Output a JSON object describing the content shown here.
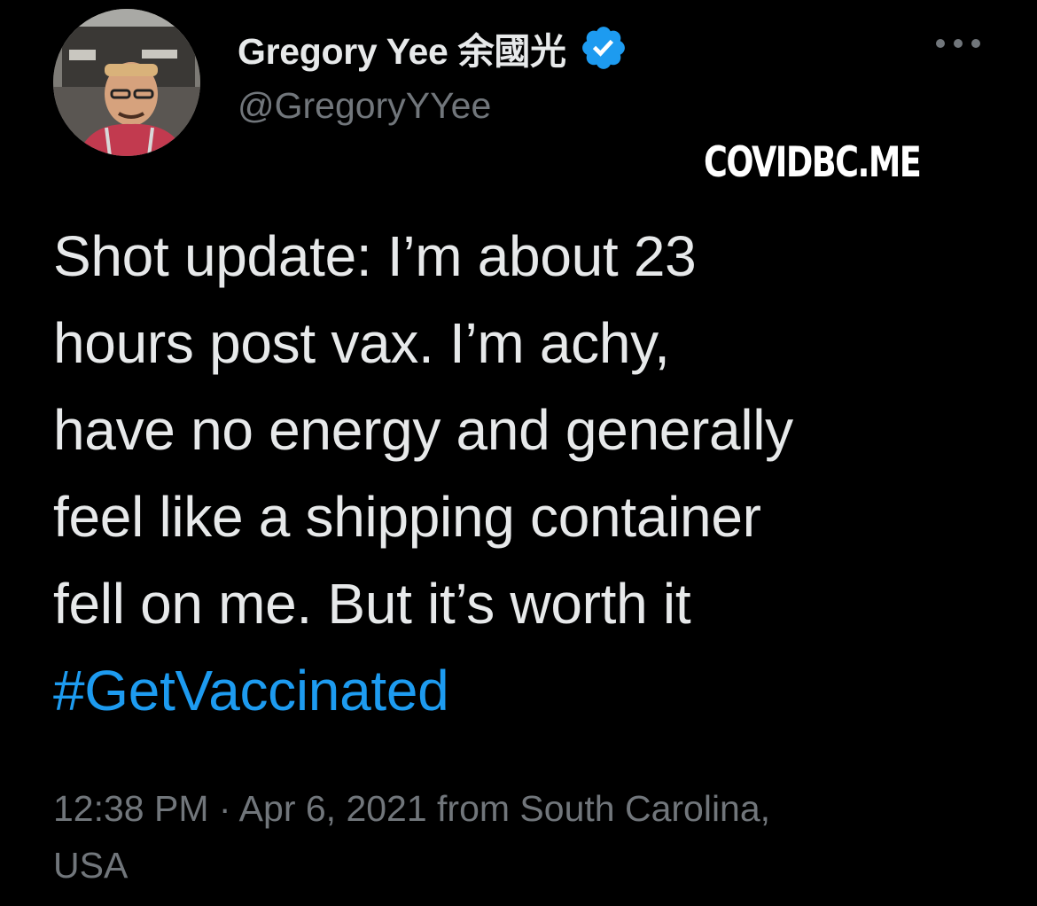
{
  "author": {
    "display_name": "Gregory Yee 余國光",
    "handle": "@GregoryYYee",
    "verified": true,
    "verified_color": "#1d9bf0"
  },
  "watermark": "COVIDBC.ME",
  "tweet": {
    "lines": [
      "Shot update: I’m about 23",
      "hours post vax. I’m achy,",
      "have no energy and generally",
      "feel like a shipping container",
      "fell on me. But it’s worth it"
    ],
    "hashtag": "#GetVaccinated",
    "hashtag_color": "#1d9bf0"
  },
  "meta": {
    "line1": "12:38 PM · Apr 6, 2021 from South Carolina,",
    "line2": "USA"
  },
  "icons": {
    "avatar": "profile-photo",
    "verified": "verified-badge-icon",
    "more": "more-options-icon"
  },
  "colors": {
    "background": "#000000",
    "text": "#e7e9ea",
    "secondary_text": "#71767b"
  }
}
